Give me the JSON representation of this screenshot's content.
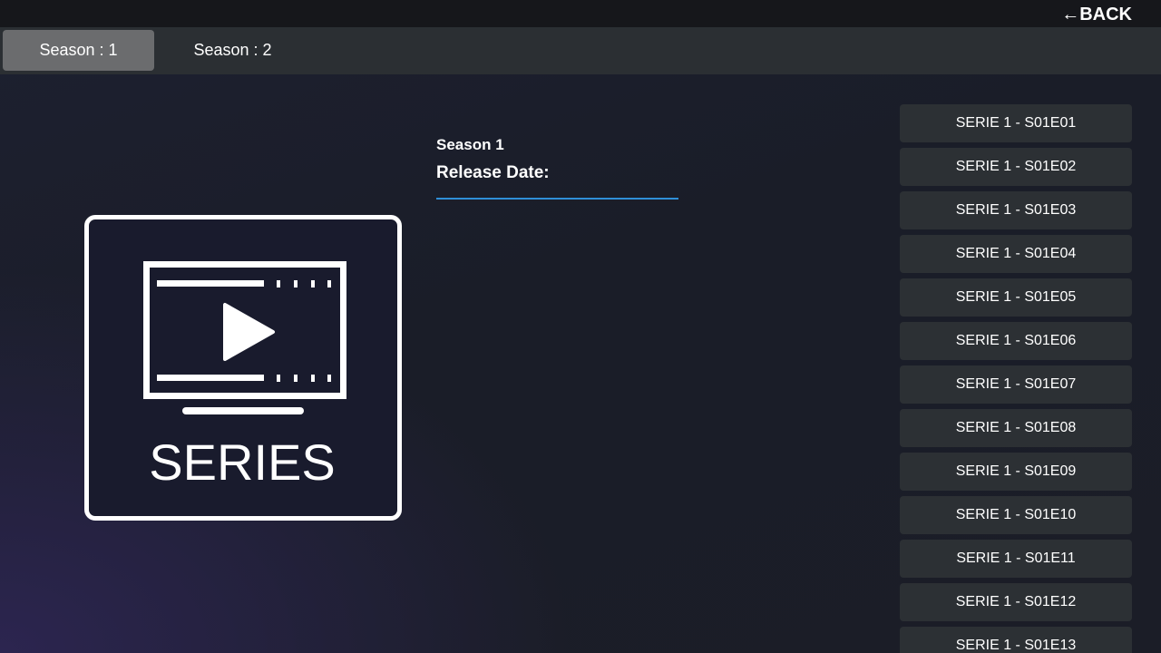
{
  "header": {
    "back_label": "←BACK"
  },
  "tabs": [
    {
      "label": "Season : 1",
      "active": true
    },
    {
      "label": "Season : 2",
      "active": false
    }
  ],
  "poster": {
    "text": "SERIES",
    "icon": "tv-play-icon"
  },
  "info": {
    "season_title": "Season 1",
    "release_label": "Release Date:"
  },
  "episodes": [
    "SERIE 1 - S01E01",
    "SERIE 1 - S01E02",
    "SERIE 1 - S01E03",
    "SERIE 1 - S01E04",
    "SERIE 1 - S01E05",
    "SERIE 1 - S01E06",
    "SERIE 1 - S01E07",
    "SERIE 1 - S01E08",
    "SERIE 1 - S01E09",
    "SERIE 1 - S01E10",
    "SERIE 1 - S01E11",
    "SERIE 1 - S01E12",
    "SERIE 1 - S01E13"
  ],
  "colors": {
    "accent": "#2f8fd8",
    "tab_active": "#6b6c6e",
    "episode_bg": "#2c3034"
  }
}
